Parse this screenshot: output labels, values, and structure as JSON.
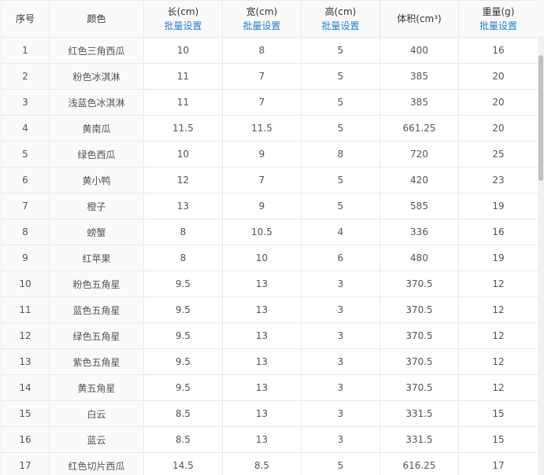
{
  "columns": [
    {
      "title": "序号",
      "link": ""
    },
    {
      "title": "颜色",
      "link": ""
    },
    {
      "title": "长(cm)",
      "link": "批量设置"
    },
    {
      "title": "宽(cm)",
      "link": "批量设置"
    },
    {
      "title": "高(cm)",
      "link": "批量设置"
    },
    {
      "title": "体积(cm³)",
      "link": ""
    },
    {
      "title": "重量(g)",
      "link": "批量设置"
    }
  ],
  "rows": [
    [
      "1",
      "红色三角西瓜",
      "10",
      "8",
      "5",
      "400",
      "16"
    ],
    [
      "2",
      "粉色冰淇淋",
      "11",
      "7",
      "5",
      "385",
      "20"
    ],
    [
      "3",
      "浅蓝色冰淇淋",
      "11",
      "7",
      "5",
      "385",
      "20"
    ],
    [
      "4",
      "黄南瓜",
      "11.5",
      "11.5",
      "5",
      "661.25",
      "20"
    ],
    [
      "5",
      "绿色西瓜",
      "10",
      "9",
      "8",
      "720",
      "25"
    ],
    [
      "6",
      "黄小鸭",
      "12",
      "7",
      "5",
      "420",
      "23"
    ],
    [
      "7",
      "橙子",
      "13",
      "9",
      "5",
      "585",
      "19"
    ],
    [
      "8",
      "螃蟹",
      "8",
      "10.5",
      "4",
      "336",
      "16"
    ],
    [
      "9",
      "红苹果",
      "8",
      "10",
      "6",
      "480",
      "19"
    ],
    [
      "10",
      "粉色五角星",
      "9.5",
      "13",
      "3",
      "370.5",
      "12"
    ],
    [
      "11",
      "蓝色五角星",
      "9.5",
      "13",
      "3",
      "370.5",
      "12"
    ],
    [
      "12",
      "绿色五角星",
      "9.5",
      "13",
      "3",
      "370.5",
      "12"
    ],
    [
      "13",
      "紫色五角星",
      "9.5",
      "13",
      "3",
      "370.5",
      "12"
    ],
    [
      "14",
      "黄五角星",
      "9.5",
      "13",
      "3",
      "370.5",
      "12"
    ],
    [
      "15",
      "白云",
      "8.5",
      "13",
      "3",
      "331.5",
      "15"
    ],
    [
      "16",
      "蓝云",
      "8.5",
      "13",
      "3",
      "331.5",
      "15"
    ],
    [
      "17",
      "红色切片西瓜",
      "14.5",
      "8.5",
      "5",
      "616.25",
      "17"
    ]
  ]
}
